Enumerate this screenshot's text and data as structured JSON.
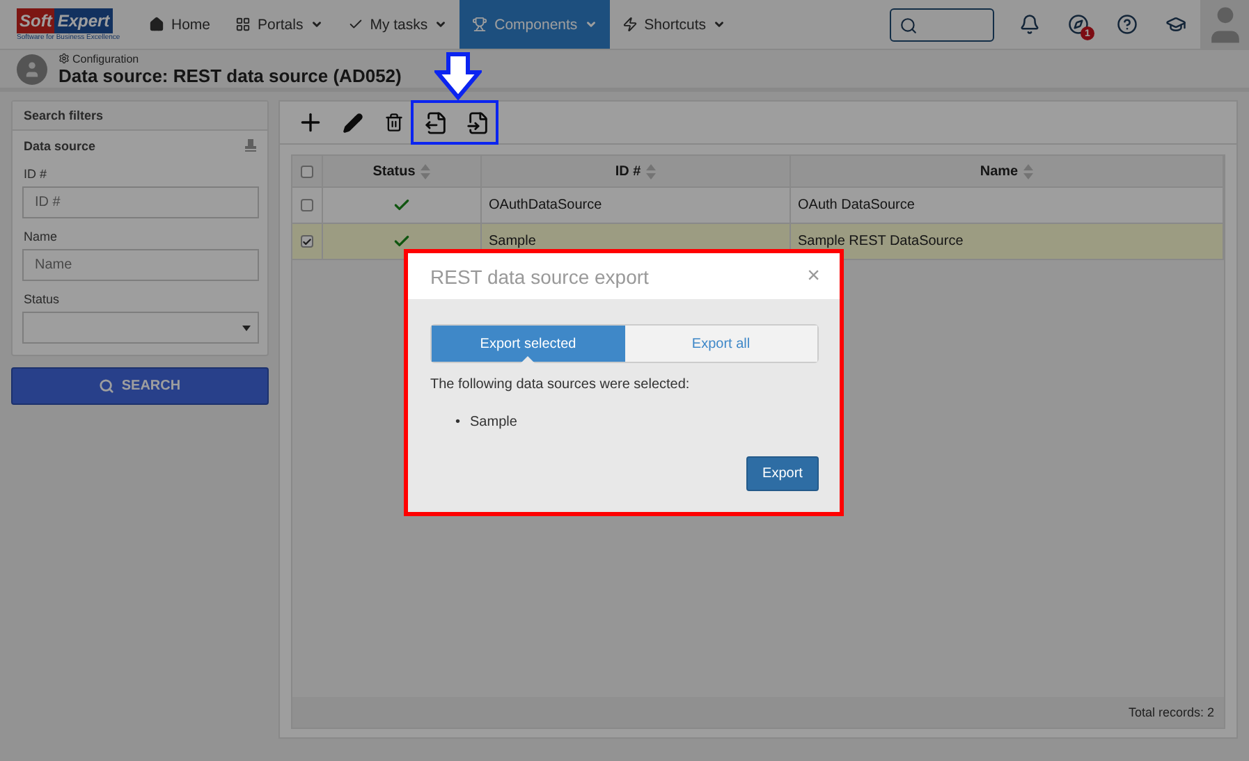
{
  "brand": {
    "top": "Soft",
    "bottom": "Expert",
    "tagline": "Software for Business Excellence"
  },
  "nav": [
    {
      "label": "Home",
      "dropdown": false,
      "selected": false
    },
    {
      "label": "Portals",
      "dropdown": true,
      "selected": false
    },
    {
      "label": "My tasks",
      "dropdown": true,
      "selected": false
    },
    {
      "label": "Components",
      "dropdown": true,
      "selected": true
    },
    {
      "label": "Shortcuts",
      "dropdown": true,
      "selected": false
    }
  ],
  "notifications": {
    "badge": "1"
  },
  "header": {
    "breadcrumb": "Configuration",
    "title": "Data source: REST data source (AD052)"
  },
  "filters": {
    "title": "Search filters",
    "section": "Data source",
    "fields": [
      {
        "label": "ID #",
        "placeholder": "ID #",
        "kind": "text"
      },
      {
        "label": "Name",
        "placeholder": "Name",
        "kind": "text"
      },
      {
        "label": "Status",
        "kind": "select"
      }
    ],
    "button": "SEARCH"
  },
  "table": {
    "all_checked": false,
    "columns": [
      "Status",
      "ID #",
      "Name"
    ],
    "rows": [
      {
        "checked": false,
        "selected": false,
        "status": true,
        "id": "OAuthDataSource",
        "name": "OAuth DataSource"
      },
      {
        "checked": true,
        "selected": true,
        "status": true,
        "id": "Sample",
        "name": "Sample REST DataSource"
      }
    ],
    "footer": "Total records: 2"
  },
  "dialog": {
    "title": "REST data source export",
    "close": "×",
    "tabs": [
      {
        "label": "Export selected",
        "selected": true
      },
      {
        "label": "Export all",
        "selected": false
      }
    ],
    "message": "The following data sources were selected:",
    "bullet": "•",
    "items": [
      "Sample"
    ],
    "button": "Export"
  }
}
